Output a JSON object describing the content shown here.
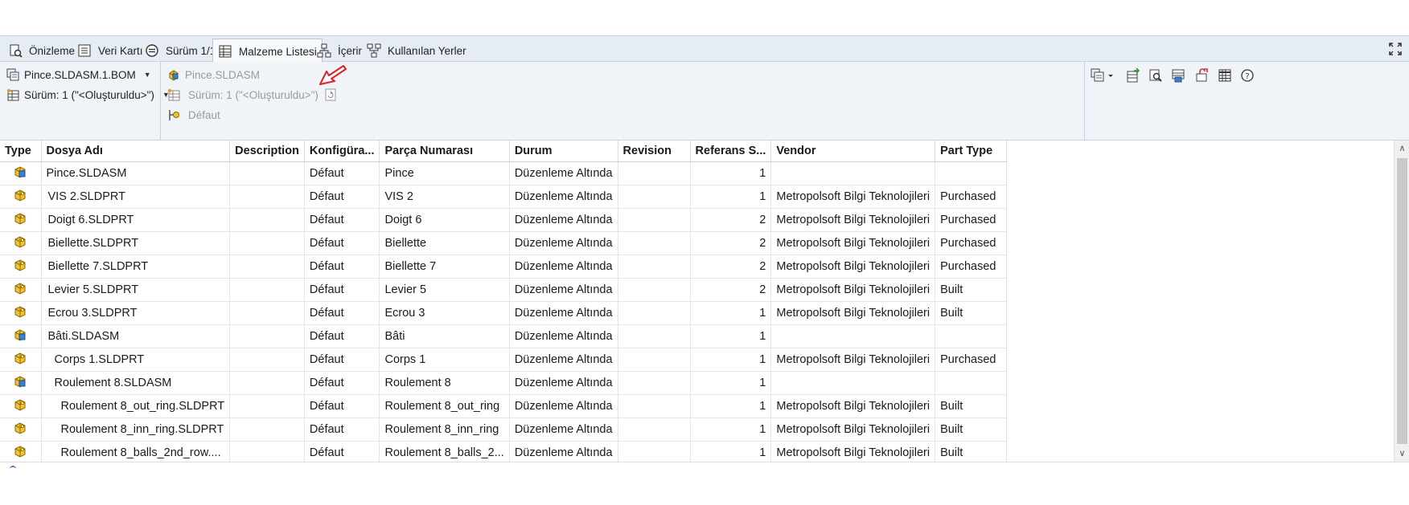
{
  "tabs": [
    {
      "label": "Önizleme",
      "icon": "preview-icon"
    },
    {
      "label": "Veri Kartı",
      "icon": "datacard-icon"
    },
    {
      "label": "Sürüm 1/1",
      "icon": "version-icon"
    },
    {
      "label": "Malzeme Listesi",
      "icon": "bom-icon",
      "active": true
    },
    {
      "label": "İçerir",
      "icon": "contains-icon"
    },
    {
      "label": "Kullanılan Yerler",
      "icon": "where-used-icon"
    }
  ],
  "toolbar": {
    "bom_select": "Pince.SLDASM.1.BOM",
    "version_select": "Sürüm: 1 (\"<Oluşturuldu>\")",
    "file_name": "Pince.SLDASM",
    "file_version": "Sürüm: 1 (\"<Oluşturuldu>\")",
    "configuration": "Défaut"
  },
  "grid": {
    "headers": [
      "Type",
      "Dosya Adı",
      "Description",
      "Konfigüra...",
      "Parça Numarası",
      "Durum",
      "Revision",
      "Referans S...",
      "Vendor",
      "Part Type"
    ],
    "rows": [
      {
        "type": "assembly",
        "file": "Pince.SLDASM",
        "indent": 0,
        "desc": "",
        "config": "Défaut",
        "part": "Pince",
        "state": "Düzenleme Altında",
        "rev": "",
        "ref": "1",
        "vendor": "",
        "ptype": ""
      },
      {
        "type": "part",
        "file": "VIS 2.SLDPRT",
        "indent": 1,
        "desc": "",
        "config": "Défaut",
        "part": "VIS 2",
        "state": "Düzenleme Altında",
        "rev": "",
        "ref": "1",
        "vendor": "Metropolsoft Bilgi Teknolojileri",
        "ptype": "Purchased"
      },
      {
        "type": "part",
        "file": "Doigt 6.SLDPRT",
        "indent": 1,
        "desc": "",
        "config": "Défaut",
        "part": "Doigt 6",
        "state": "Düzenleme Altında",
        "rev": "",
        "ref": "2",
        "vendor": "Metropolsoft Bilgi Teknolojileri",
        "ptype": "Purchased"
      },
      {
        "type": "part",
        "file": "Biellette.SLDPRT",
        "indent": 1,
        "desc": "",
        "config": "Défaut",
        "part": "Biellette",
        "state": "Düzenleme Altında",
        "rev": "",
        "ref": "2",
        "vendor": "Metropolsoft Bilgi Teknolojileri",
        "ptype": "Purchased"
      },
      {
        "type": "part",
        "file": "Biellette 7.SLDPRT",
        "indent": 1,
        "desc": "",
        "config": "Défaut",
        "part": "Biellette 7",
        "state": "Düzenleme Altında",
        "rev": "",
        "ref": "2",
        "vendor": "Metropolsoft Bilgi Teknolojileri",
        "ptype": "Purchased"
      },
      {
        "type": "part",
        "file": "Levier 5.SLDPRT",
        "indent": 1,
        "desc": "",
        "config": "Défaut",
        "part": "Levier 5",
        "state": "Düzenleme Altında",
        "rev": "",
        "ref": "2",
        "vendor": "Metropolsoft Bilgi Teknolojileri",
        "ptype": "Built"
      },
      {
        "type": "part",
        "file": "Ecrou 3.SLDPRT",
        "indent": 1,
        "desc": "",
        "config": "Défaut",
        "part": "Ecrou 3",
        "state": "Düzenleme Altında",
        "rev": "",
        "ref": "1",
        "vendor": "Metropolsoft Bilgi Teknolojileri",
        "ptype": "Built"
      },
      {
        "type": "assembly",
        "file": "Bâti.SLDASM",
        "indent": 1,
        "desc": "",
        "config": "Défaut",
        "part": "Bâti",
        "state": "Düzenleme Altında",
        "rev": "",
        "ref": "1",
        "vendor": "",
        "ptype": ""
      },
      {
        "type": "part",
        "file": "Corps 1.SLDPRT",
        "indent": 2,
        "desc": "",
        "config": "Défaut",
        "part": "Corps 1",
        "state": "Düzenleme Altında",
        "rev": "",
        "ref": "1",
        "vendor": "Metropolsoft Bilgi Teknolojileri",
        "ptype": "Purchased"
      },
      {
        "type": "assembly",
        "file": "Roulement 8.SLDASM",
        "indent": 2,
        "desc": "",
        "config": "Défaut",
        "part": "Roulement 8",
        "state": "Düzenleme Altında",
        "rev": "",
        "ref": "1",
        "vendor": "",
        "ptype": ""
      },
      {
        "type": "part",
        "file": "Roulement 8_out_ring.SLDPRT",
        "indent": 3,
        "desc": "",
        "config": "Défaut",
        "part": "Roulement 8_out_ring",
        "state": "Düzenleme Altında",
        "rev": "",
        "ref": "1",
        "vendor": "Metropolsoft Bilgi Teknolojileri",
        "ptype": "Built"
      },
      {
        "type": "part",
        "file": "Roulement 8_inn_ring.SLDPRT",
        "indent": 3,
        "desc": "",
        "config": "Défaut",
        "part": "Roulement 8_inn_ring",
        "state": "Düzenleme Altında",
        "rev": "",
        "ref": "1",
        "vendor": "Metropolsoft Bilgi Teknolojileri",
        "ptype": "Built"
      },
      {
        "type": "part",
        "file": "Roulement 8_balls_2nd_row....",
        "indent": 3,
        "desc": "",
        "config": "Défaut",
        "part": "Roulement 8_balls_2...",
        "state": "Düzenleme Altında",
        "rev": "",
        "ref": "1",
        "vendor": "Metropolsoft Bilgi Teknolojileri",
        "ptype": "Built"
      }
    ]
  },
  "colors": {
    "tabbar": "#e6ecf3",
    "toolarea": "#f0f4f8",
    "accent": "#2f6db5",
    "arrow": "#e02020"
  }
}
